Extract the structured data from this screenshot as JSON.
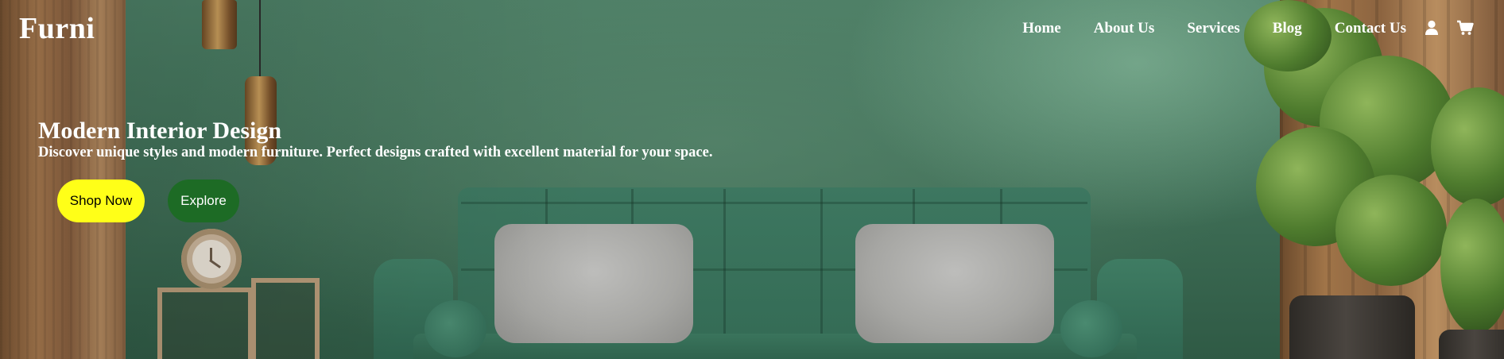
{
  "brand": {
    "name": "Furni"
  },
  "nav": {
    "links": [
      {
        "label": "Home"
      },
      {
        "label": "About Us"
      },
      {
        "label": "Services"
      },
      {
        "label": "Blog"
      },
      {
        "label": "Contact Us"
      }
    ],
    "icons": [
      "user-icon",
      "cart-icon"
    ]
  },
  "hero": {
    "title": "Modern Interior Design",
    "subtitle": "Discover unique styles and modern furniture. Perfect designs crafted with excellent material for your space.",
    "buttons": {
      "shop_label": "Shop Now",
      "explore_label": "Explore"
    },
    "background": "living-room-photo"
  },
  "colors": {
    "shop_button_bg": "#ffff18",
    "explore_button_bg": "#1d6b25",
    "wall_green": "#3f6e57",
    "text": "#ffffff"
  }
}
